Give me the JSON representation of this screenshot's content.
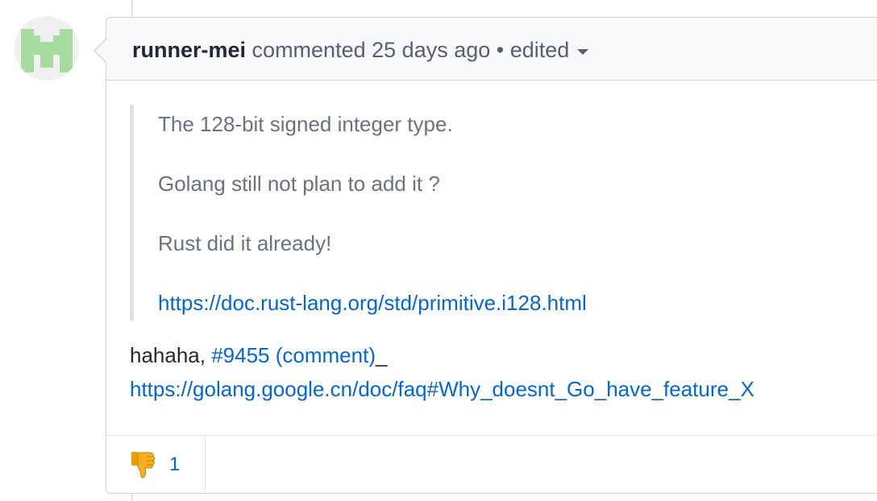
{
  "comment": {
    "author": "runner-mei",
    "action": "commented",
    "time": "25 days ago",
    "separator": "•",
    "edited_label": "edited",
    "quote": [
      "The 128-bit signed integer type.",
      "Golang still not plan to add it ?",
      "Rust did it already!"
    ],
    "quote_link": "https://doc.rust-lang.org/std/primitive.i128.html",
    "reply_prefix": "hahaha, ",
    "reply_issue_link": "#9455 (comment)",
    "reply_suffix": "_",
    "reply_faq_link": "https://golang.google.cn/doc/faq#Why_doesnt_Go_have_feature_X"
  },
  "reactions": [
    {
      "icon": "thumbs-down-icon",
      "count": "1"
    }
  ],
  "colors": {
    "link": "#0366d6",
    "header_bg": "#f6f8fa",
    "border": "#d1d5da",
    "avatar_fill": "#a6dca0",
    "reaction_emoji": "#f6b01e"
  }
}
